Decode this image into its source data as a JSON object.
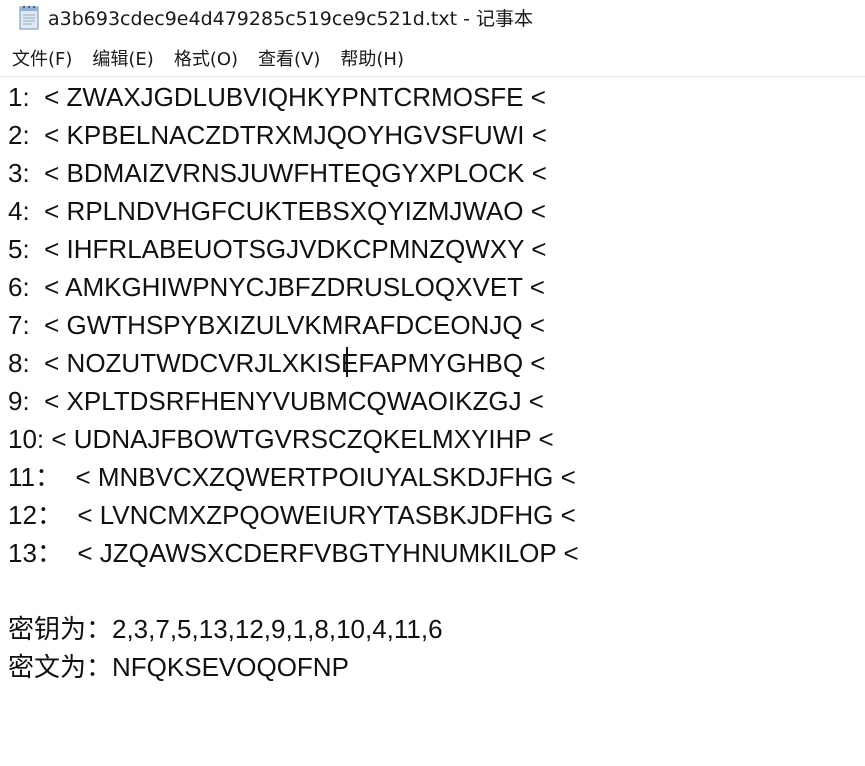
{
  "window": {
    "title": "a3b693cdec9e4d479285c519ce9c521d.txt - 记事本"
  },
  "menu": [
    {
      "label": "文件(F)"
    },
    {
      "label": "编辑(E)"
    },
    {
      "label": "格式(O)"
    },
    {
      "label": "查看(V)"
    },
    {
      "label": "帮助(H)"
    }
  ],
  "editor": {
    "lines": [
      "1:  < ZWAXJGDLUBVIQHKYPNTCRMOSFE <",
      "2:  < KPBELNACZDTRXMJQOYHGVSFUWI <",
      "3:  < BDMAIZVRNSJUWFHTEQGYXPLOCK <",
      "4:  < RPLNDVHGFCUKTEBSXQYIZMJWAO <",
      "5:  < IHFRLABEUOTSGJVDKCPMNZQWXY <",
      "6:  < AMKGHIWPNYCJBFZDRUSLOQXVET <",
      "7:  < GWTHSPYBXIZULVKMRAFDCEONJQ <",
      "8:  < NOZUTWDCVRJLXKISEFAPMYGHBQ <",
      "9:  < XPLTDSRFHENYVUBMCQWAOIKZGJ <",
      "10: < UDNAJFBOWTGVRSCZQKELMXYIHP <",
      "11：  < MNBVCXZQWERTPOIUYALSKDJFHG <",
      "12：  < LVNCMXZPQOWEIURYTASBKJDFHG <",
      "13：  < JZQAWSXCDERFVBGTYHNUMKILOP <",
      "",
      "密钥为：2,3,7,5,13,12,9,1,8,10,4,11,6",
      "密文为：NFQKSEVOQOFNP"
    ]
  }
}
